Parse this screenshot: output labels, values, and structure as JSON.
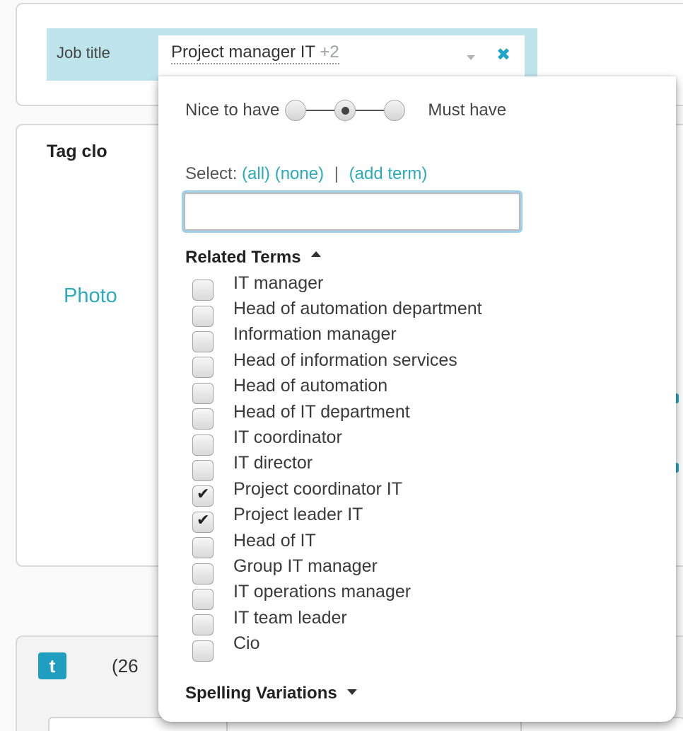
{
  "filter": {
    "label": "Job title",
    "value": "Project manager IT",
    "extra_count": "+2",
    "clear_icon": "close-icon",
    "accent_color": "#1ea5c9"
  },
  "background": {
    "tagcloud_title": "Tag clo",
    "tagcloud_link": "Photo",
    "twitter_icon_letter": "t",
    "twitter_count": "(26"
  },
  "dropdown": {
    "priority": {
      "left_label": "Nice to have",
      "right_label": "Must have",
      "options": [
        "nice-to-have",
        "neutral",
        "must-have"
      ],
      "selected_index": 1
    },
    "select": {
      "label": "Select:",
      "all": "(all)",
      "none": "(none)",
      "separator": "|",
      "add_term": "(add term)"
    },
    "search": {
      "value": "",
      "placeholder": ""
    },
    "related_terms": {
      "heading": "Related Terms",
      "expanded": true,
      "items": [
        {
          "label": "IT manager",
          "checked": false
        },
        {
          "label": "Head of automation department",
          "checked": false
        },
        {
          "label": "Information manager",
          "checked": false
        },
        {
          "label": "Head of information services",
          "checked": false
        },
        {
          "label": "Head of automation",
          "checked": false
        },
        {
          "label": "Head of IT department",
          "checked": false
        },
        {
          "label": "IT coordinator",
          "checked": false
        },
        {
          "label": "IT director",
          "checked": false
        },
        {
          "label": "Project coordinator IT",
          "checked": true
        },
        {
          "label": "Project leader IT",
          "checked": true
        },
        {
          "label": "Head of IT",
          "checked": false
        },
        {
          "label": "Group IT manager",
          "checked": false
        },
        {
          "label": "IT operations manager",
          "checked": false
        },
        {
          "label": "IT team leader",
          "checked": false
        },
        {
          "label": "Cio",
          "checked": false
        }
      ]
    },
    "spelling_variations": {
      "heading": "Spelling Variations",
      "expanded": false
    }
  }
}
